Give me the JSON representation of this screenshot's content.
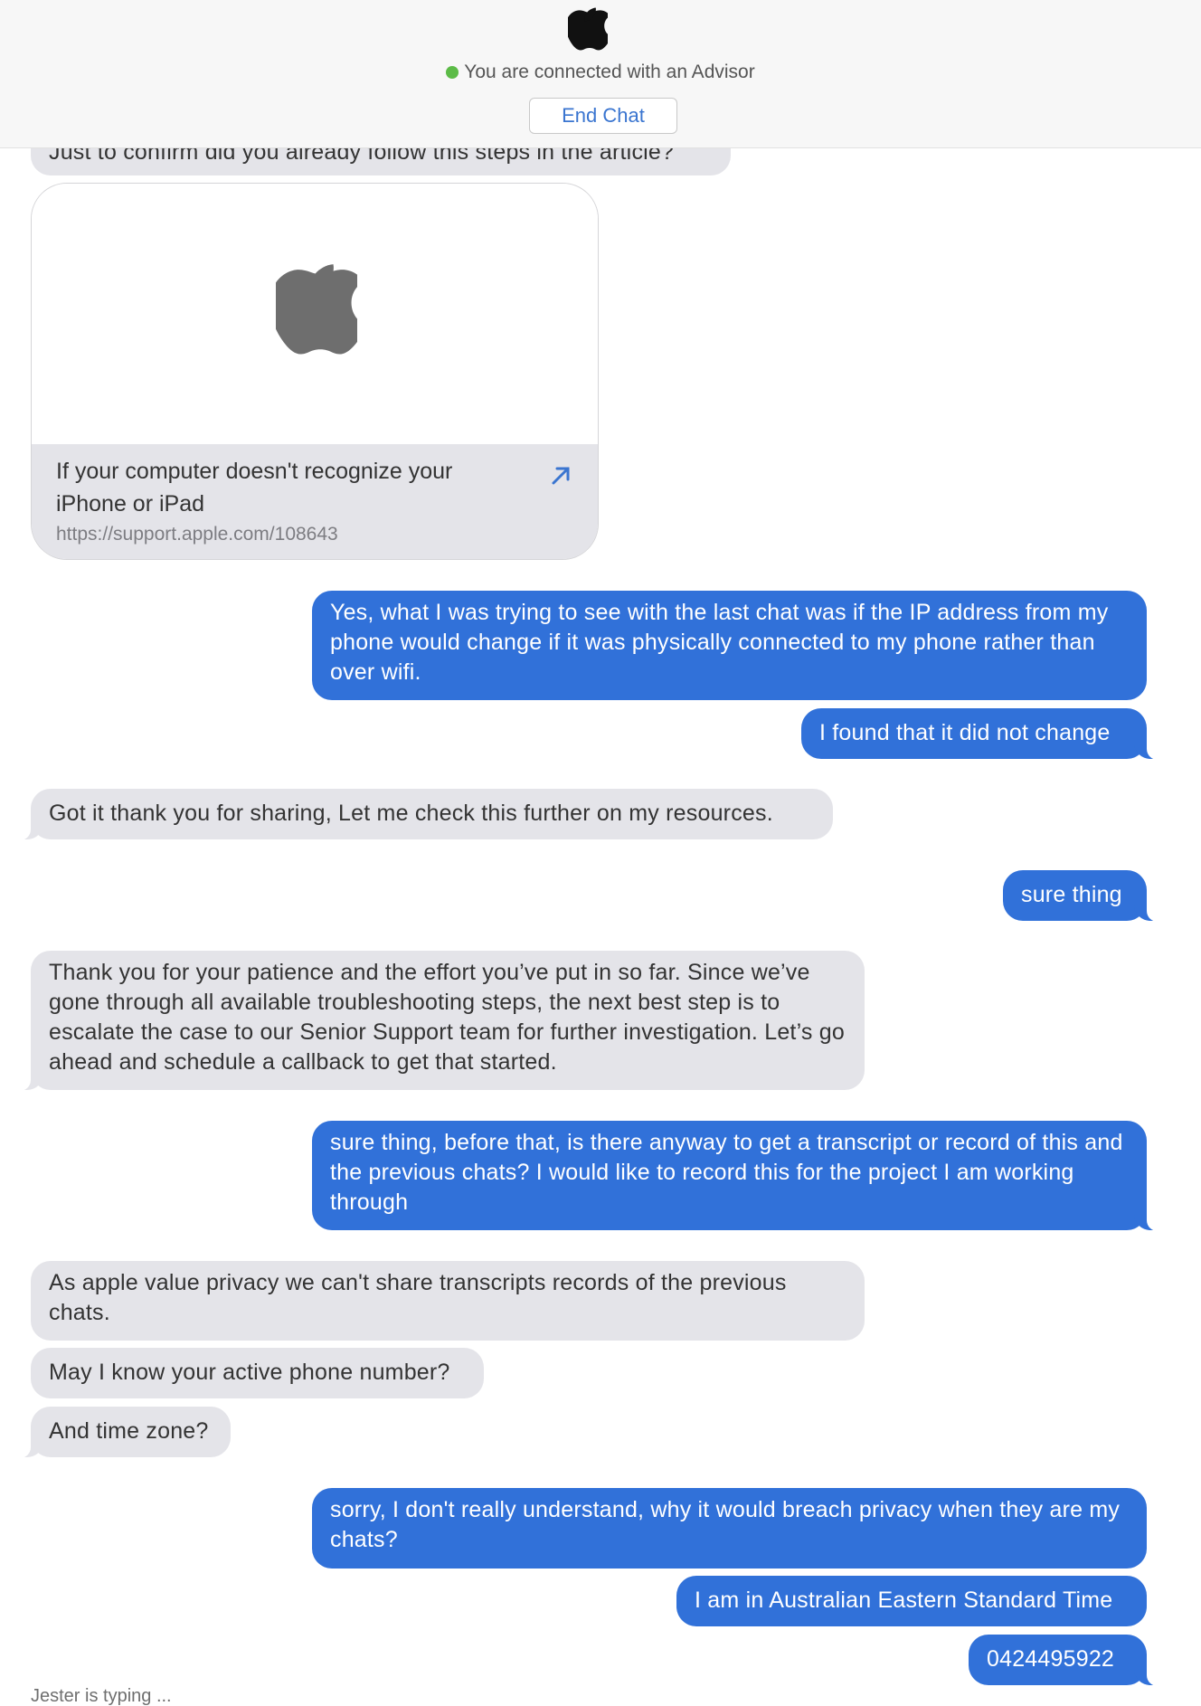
{
  "header": {
    "status_text": "You are connected with an Advisor",
    "end_chat_label": "End Chat"
  },
  "messages": [
    {
      "from": "advisor",
      "text": "Just to confirm did you already follow this steps in the article?"
    },
    {
      "from": "advisor",
      "type": "link",
      "title": "If your computer doesn't recognize your iPhone or iPad",
      "url": "https://support.apple.com/108643"
    },
    {
      "from": "user",
      "text": "Yes, what I was trying to see with the last chat was if the IP address from my phone would change if it was physically connected to my phone rather than over wifi."
    },
    {
      "from": "user",
      "text": "I found that it did not change"
    },
    {
      "from": "advisor",
      "text": "Got it thank you for sharing, Let me check this further on my resources."
    },
    {
      "from": "user",
      "text": "sure thing"
    },
    {
      "from": "advisor",
      "text": "Thank you for your patience and the effort you’ve put in so far. Since we’ve gone through all available troubleshooting steps, the next best step is to escalate the case to our Senior Support team for further investigation. Let’s go ahead and schedule a callback to get that started."
    },
    {
      "from": "user",
      "text": "sure thing, before that, is there anyway to get a transcript or record of this and the previous chats? I would like to record this for the project I am working through"
    },
    {
      "from": "advisor",
      "text": "As apple value privacy we can't share transcripts records of the previous chats."
    },
    {
      "from": "advisor",
      "text": "May I know your active phone number?"
    },
    {
      "from": "advisor",
      "text": "And time zone?"
    },
    {
      "from": "user",
      "text": "sorry, I don't really understand, why it would breach privacy when they are my chats?"
    },
    {
      "from": "user",
      "text": "I am in Australian Eastern Standard Time"
    },
    {
      "from": "user",
      "text": "0424495922"
    }
  ],
  "typing_indicator": "Jester is typing ...",
  "colors": {
    "outgoing_bubble": "#3171d9",
    "incoming_bubble": "#e4e4e9",
    "status_dot": "#5cbb47",
    "link_accent": "#3a75d0"
  },
  "icons": [
    "apple-logo-icon",
    "external-link-arrow-icon"
  ]
}
